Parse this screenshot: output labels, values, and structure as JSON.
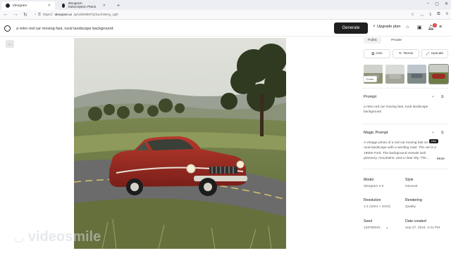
{
  "browser": {
    "tabs": [
      {
        "label": "Ideogram",
        "active": true
      },
      {
        "label": "Ideogram Subscription Plans",
        "active": false
      }
    ],
    "url_host": "ideogram.ai",
    "url_prefix": "https://",
    "url_path": "/g/UZ8WBHTj2SuAhWmy_rg/0"
  },
  "app": {
    "prompt_text": "a retro red car moving fast, rural landscape background",
    "generate_label": "Generate",
    "upgrade_label": "Upgrade plan",
    "notification_count": "1"
  },
  "panel": {
    "visibility_tabs": [
      "Public",
      "Private"
    ],
    "actions": [
      {
        "label": "Use",
        "icon": "copy-icon"
      },
      {
        "label": "Remix",
        "icon": "remix-icon"
      },
      {
        "label": "Upscale",
        "icon": "upscale-icon"
      }
    ],
    "cover_label": "Cover",
    "prompt_title": "Prompt",
    "prompt_body": "a retro red car moving fast, rural landscape background",
    "magic_prompt_title": "Magic Prompt",
    "magic_prompt_body": "A vintage photo of a red car moving fast on a rural landscape with a winding road. The car is a 1950s Ford. The background reveals lush greenery, mountains, and a clear sky. The...",
    "more_label": "More",
    "tooltip": "Use",
    "model_label": "Model",
    "model_value": "Ideogram 2.0",
    "style_label": "Style",
    "style_value": "General",
    "resolution_label": "Resolution",
    "resolution_value": "1:1 (1024 × 1024)",
    "rendering_label": "Rendering",
    "rendering_value": "Quality",
    "seed_label": "Seed",
    "seed_value": "128769041",
    "date_label": "Date created",
    "date_value": "Sep 27, 2024, 4:41 PM"
  },
  "watermark": "videosmile",
  "colors": {
    "car_red": "#9c2a22",
    "sky": "#cfd3c9",
    "grass": "#6f7d45",
    "road": "#6b6b6b"
  }
}
